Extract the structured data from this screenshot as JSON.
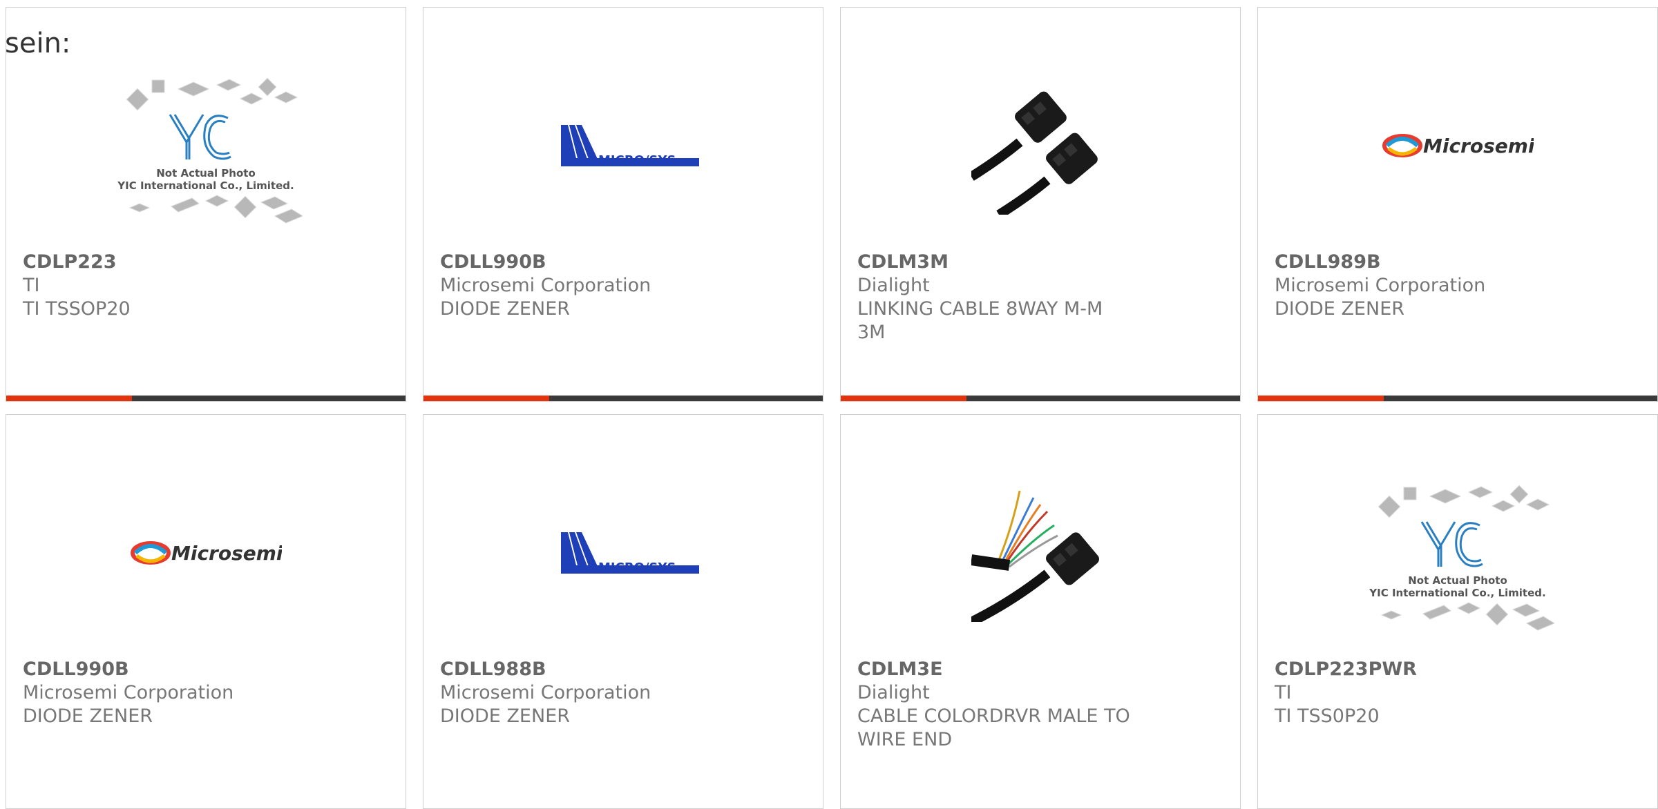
{
  "stray_text": "sein:",
  "cards": [
    {
      "part": "CDLP223",
      "manufacturer": "TI",
      "description": "TI TSSOP20",
      "image": "placeholder",
      "placeholder_line1": "Not Actual Photo",
      "placeholder_line2": "YIC International Co., Limited.",
      "logo_text": "YIC"
    },
    {
      "part": "CDLL990B",
      "manufacturer": "Microsemi Corporation",
      "description": "DIODE ZENER",
      "image": "microsys-logo",
      "logo_text": "MICRO/SYS"
    },
    {
      "part": "CDLM3M",
      "manufacturer": "Dialight",
      "description": "LINKING CABLE 8WAY M-M 3M",
      "image": "cable-photo"
    },
    {
      "part": "CDLL989B",
      "manufacturer": "Microsemi Corporation",
      "description": "DIODE ZENER",
      "image": "microsemi-logo",
      "logo_text": "Microsemi"
    },
    {
      "part": "CDLL990B",
      "manufacturer": "Microsemi Corporation",
      "description": "DIODE ZENER",
      "image": "microsemi-logo",
      "logo_text": "Microsemi"
    },
    {
      "part": "CDLL988B",
      "manufacturer": "Microsemi Corporation",
      "description": "DIODE ZENER",
      "image": "microsys-logo",
      "logo_text": "MICRO/SYS"
    },
    {
      "part": "CDLM3E",
      "manufacturer": "Dialight",
      "description": "CABLE COLORDRVR MALE TO WIRE END",
      "image": "cable-wire-photo"
    },
    {
      "part": "CDLP223PWR",
      "manufacturer": "TI",
      "description": "TI TSS0P20",
      "image": "placeholder",
      "placeholder_line1": "Not Actual Photo",
      "placeholder_line2": "YIC International Co., Limited.",
      "logo_text": "YIC"
    }
  ],
  "colors": {
    "accent_bar": "#e3330d",
    "dark_bar": "#3a3a3a",
    "microsys_blue": "#1f3fb8",
    "yic_blue": "#2a7fc0"
  }
}
